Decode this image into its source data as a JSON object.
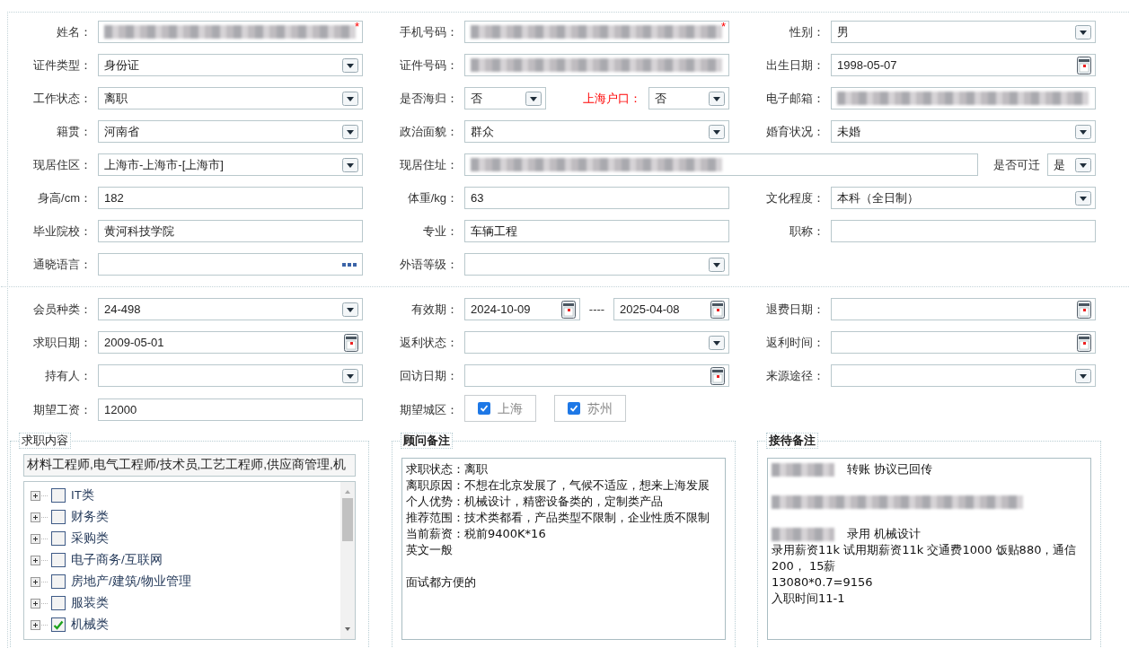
{
  "personal": {
    "rows": [
      [
        {
          "label": "姓名：",
          "fields": [
            {
              "kind": "text",
              "redacted": true,
              "required_mark": "*"
            }
          ]
        },
        {
          "label": "手机号码：",
          "fields": [
            {
              "kind": "text",
              "redacted": true,
              "required_mark": "*"
            }
          ]
        },
        {
          "label": "性别：",
          "fields": [
            {
              "kind": "select",
              "value": "男"
            }
          ]
        }
      ],
      [
        {
          "label": "证件类型：",
          "fields": [
            {
              "kind": "select",
              "value": "身份证"
            }
          ]
        },
        {
          "label": "证件号码：",
          "fields": [
            {
              "kind": "text",
              "redacted": true
            }
          ]
        },
        {
          "label": "出生日期：",
          "fields": [
            {
              "kind": "date",
              "value": "1998-05-07"
            }
          ]
        }
      ],
      [
        {
          "label": "工作状态：",
          "fields": [
            {
              "kind": "select",
              "value": "离职"
            }
          ]
        },
        {
          "label": "是否海归：",
          "fields": [
            {
              "kind": "select",
              "value": "否"
            },
            {
              "kind": "label",
              "text": "上海户口：",
              "highlighted": true
            },
            {
              "kind": "select",
              "value": "否"
            }
          ]
        },
        {
          "label": "电子邮箱：",
          "fields": [
            {
              "kind": "text",
              "redacted": true
            }
          ]
        }
      ],
      [
        {
          "label": "籍贯：",
          "fields": [
            {
              "kind": "select",
              "value": "河南省"
            }
          ]
        },
        {
          "label": "政治面貌：",
          "fields": [
            {
              "kind": "select",
              "value": "群众"
            }
          ]
        },
        {
          "label": "婚育状况：",
          "fields": [
            {
              "kind": "select",
              "value": "未婚"
            }
          ]
        }
      ],
      [
        {
          "label": "现居住区：",
          "fields": [
            {
              "kind": "select",
              "value": "上海市-上海市-[上海市]"
            }
          ]
        },
        {
          "label": "现居住址：",
          "fields": [
            {
              "kind": "text",
              "redacted": true
            },
            {
              "kind": "label",
              "text": "是否可迁"
            },
            {
              "kind": "select",
              "value": "是"
            }
          ]
        }
      ],
      [
        {
          "label": "身高/cm：",
          "fields": [
            {
              "kind": "text",
              "value": "182"
            }
          ]
        },
        {
          "label": "体重/kg：",
          "fields": [
            {
              "kind": "text",
              "value": "63"
            }
          ]
        },
        {
          "label": "文化程度：",
          "fields": [
            {
              "kind": "select",
              "value": "本科（全日制）"
            }
          ]
        }
      ],
      [
        {
          "label": "毕业院校：",
          "fields": [
            {
              "kind": "text",
              "value": "黄河科技学院"
            }
          ]
        },
        {
          "label": "专业：",
          "fields": [
            {
              "kind": "text",
              "value": "车辆工程"
            }
          ]
        },
        {
          "label": "职称：",
          "fields": [
            {
              "kind": "text"
            }
          ]
        }
      ],
      [
        {
          "label": "通晓语言：",
          "fields": [
            {
              "kind": "picker"
            }
          ]
        },
        {
          "label": "外语等级：",
          "fields": [
            {
              "kind": "select"
            }
          ]
        }
      ]
    ]
  },
  "membership": {
    "rows": [
      [
        {
          "label": "会员种类：",
          "fields": [
            {
              "kind": "select",
              "value": "24-498"
            }
          ]
        },
        {
          "label": "有效期：",
          "fields": [
            {
              "kind": "date",
              "value": "2024-10-09"
            },
            {
              "kind": "separator",
              "text": "----"
            },
            {
              "kind": "date",
              "value": "2025-04-08"
            }
          ]
        },
        {
          "label": "退费日期：",
          "fields": [
            {
              "kind": "date"
            }
          ]
        }
      ],
      [
        {
          "label": "求职日期：",
          "fields": [
            {
              "kind": "date",
              "value": "2009-05-01"
            }
          ]
        },
        {
          "label": "返利状态：",
          "fields": [
            {
              "kind": "select"
            }
          ]
        },
        {
          "label": "返利时间：",
          "fields": [
            {
              "kind": "date"
            }
          ]
        }
      ],
      [
        {
          "label": "持有人：",
          "fields": [
            {
              "kind": "select"
            }
          ]
        },
        {
          "label": "回访日期：",
          "fields": [
            {
              "kind": "date"
            }
          ]
        },
        {
          "label": "来源途径：",
          "fields": [
            {
              "kind": "select"
            }
          ]
        }
      ],
      [
        {
          "label": "期望工资：",
          "fields": [
            {
              "kind": "text",
              "value": "12000"
            }
          ]
        },
        {
          "label": "期望城区：",
          "fields": [
            {
              "kind": "check",
              "text": "上海",
              "checked": true
            },
            {
              "kind": "check",
              "text": "苏州",
              "checked": true
            }
          ]
        }
      ]
    ]
  },
  "job_content": {
    "title": "求职内容",
    "summary": "材料工程师,电气工程师/技术员,工艺工程师,供应商管理,机",
    "tree": [
      {
        "label": "IT类",
        "checked": false
      },
      {
        "label": "财务类",
        "checked": false
      },
      {
        "label": "采购类",
        "checked": false
      },
      {
        "label": "电子商务/互联网",
        "checked": false
      },
      {
        "label": "房地产/建筑/物业管理",
        "checked": false
      },
      {
        "label": "服装类",
        "checked": false
      },
      {
        "label": "机械类",
        "checked": true
      }
    ]
  },
  "advisor_notes": {
    "title": "顾问备注",
    "lines": [
      {
        "kind": "text",
        "text": "求职状态：离职"
      },
      {
        "kind": "text",
        "text": "离职原因：不想在北京发展了，气候不适应，想来上海发展"
      },
      {
        "kind": "text",
        "text": "个人优势：机械设计，精密设备类的，定制类产品"
      },
      {
        "kind": "text",
        "text": "推荐范围：技术类都看，产品类型不限制，企业性质不限制"
      },
      {
        "kind": "text",
        "text": "当前薪资：税前9400K*16"
      },
      {
        "kind": "text",
        "text": "英文一般"
      },
      {
        "kind": "blank"
      },
      {
        "kind": "text",
        "text": "面试都方便的"
      }
    ]
  },
  "reception_notes": {
    "title": "接待备注",
    "lines": [
      {
        "kind": "text",
        "redacted_prefix": true,
        "text": "转账 协议已回传"
      },
      {
        "kind": "blank"
      },
      {
        "kind": "redacted"
      },
      {
        "kind": "blank"
      },
      {
        "kind": "text",
        "redacted_prefix": true,
        "text": "录用  机械设计"
      },
      {
        "kind": "text",
        "text": "录用薪资11k 试用期薪资11k 交通费1000 饭贴880，通信200， 15薪"
      },
      {
        "kind": "text",
        "text": "13080*0.7=9156"
      },
      {
        "kind": "text",
        "text": "入职时间11-1"
      }
    ]
  }
}
